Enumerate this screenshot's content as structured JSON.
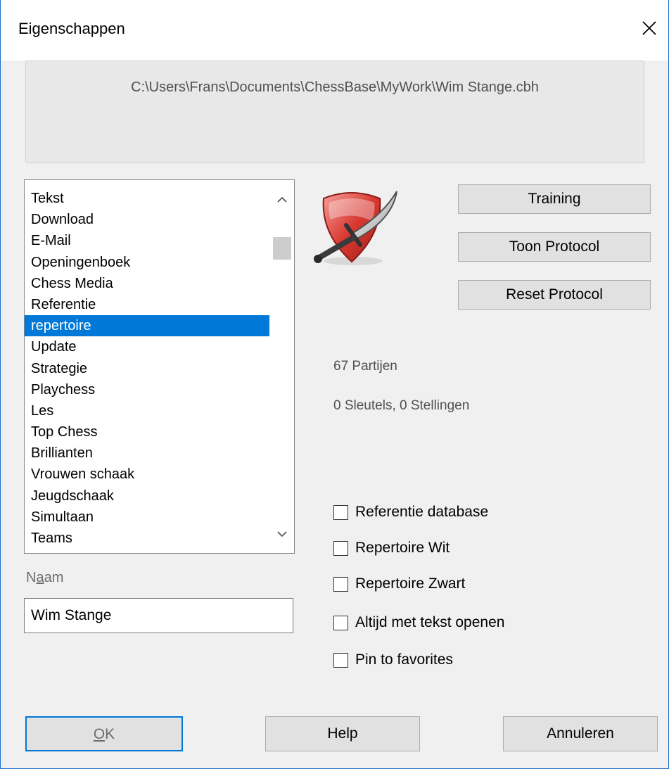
{
  "window": {
    "title": "Eigenschappen"
  },
  "path": "C:\\Users\\Frans\\Documents\\ChessBase\\MyWork\\Wim Stange.cbh",
  "icon_list": {
    "items": [
      "Tekst",
      "Download",
      "E-Mail",
      "Openingenboek",
      "Chess Media",
      "Referentie",
      "repertoire",
      "Update",
      "Strategie",
      "Playchess",
      "Les",
      "Top Chess",
      "Brillianten",
      "Vrouwen schaak",
      "Jeugdschaak",
      "Simultaan",
      "Teams"
    ],
    "selected": "repertoire",
    "scroll_up_icon": "chevron-up-icon",
    "scroll_down_icon": "chevron-down-icon"
  },
  "name_field": {
    "label_prefix": "N",
    "label_accel": "a",
    "label_suffix": "am",
    "value": "Wim Stange"
  },
  "logo_icon": "shield-sword-icon",
  "buttons": {
    "training": "Training",
    "show_protocol": "Toon Protocol",
    "reset_protocol": "Reset Protocol",
    "ok_accel": "O",
    "ok_rest": "K",
    "help": "Help",
    "cancel": "Annuleren"
  },
  "stats": {
    "games": "67 Partijen",
    "keys": "0 Sleutels, 0 Stellingen"
  },
  "checkboxes": [
    {
      "label": "Referentie database",
      "checked": false
    },
    {
      "label": "Repertoire Wit",
      "checked": false
    },
    {
      "label": "Repertoire Zwart",
      "checked": false
    },
    {
      "label": "Altijd met tekst openen",
      "checked": false
    },
    {
      "label": "Pin to favorites",
      "checked": false
    }
  ],
  "colors": {
    "selection": "#0078d7",
    "focus_border": "#0078d7"
  }
}
